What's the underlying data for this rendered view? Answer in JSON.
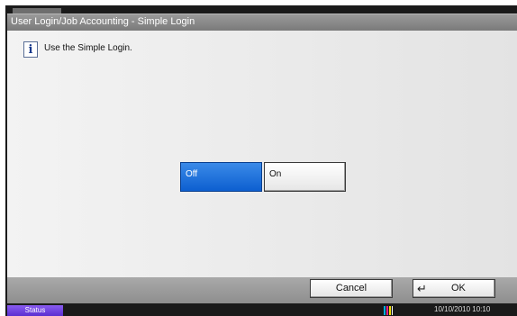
{
  "window": {
    "title": "User Login/Job Accounting - Simple Login"
  },
  "message": {
    "icon": "info-icon",
    "glyph": "i",
    "text": "Use the Simple Login."
  },
  "toggle": {
    "selected": "Off",
    "off_label": "Off",
    "on_label": "On"
  },
  "footer": {
    "cancel_label": "Cancel",
    "ok_label": "OK",
    "ok_icon": "enter-return-icon",
    "ok_glyph": "↵"
  },
  "status_bar": {
    "status_label": "Status",
    "toner_icon": "toner-level-icon",
    "datetime": "10/10/2010 10:10"
  },
  "colors": {
    "selected_button": "#0d5fd0",
    "status_button": "#6a3ee0",
    "toner": [
      "#00b0e0",
      "#e0208c",
      "#f0e000",
      "#202020"
    ]
  }
}
